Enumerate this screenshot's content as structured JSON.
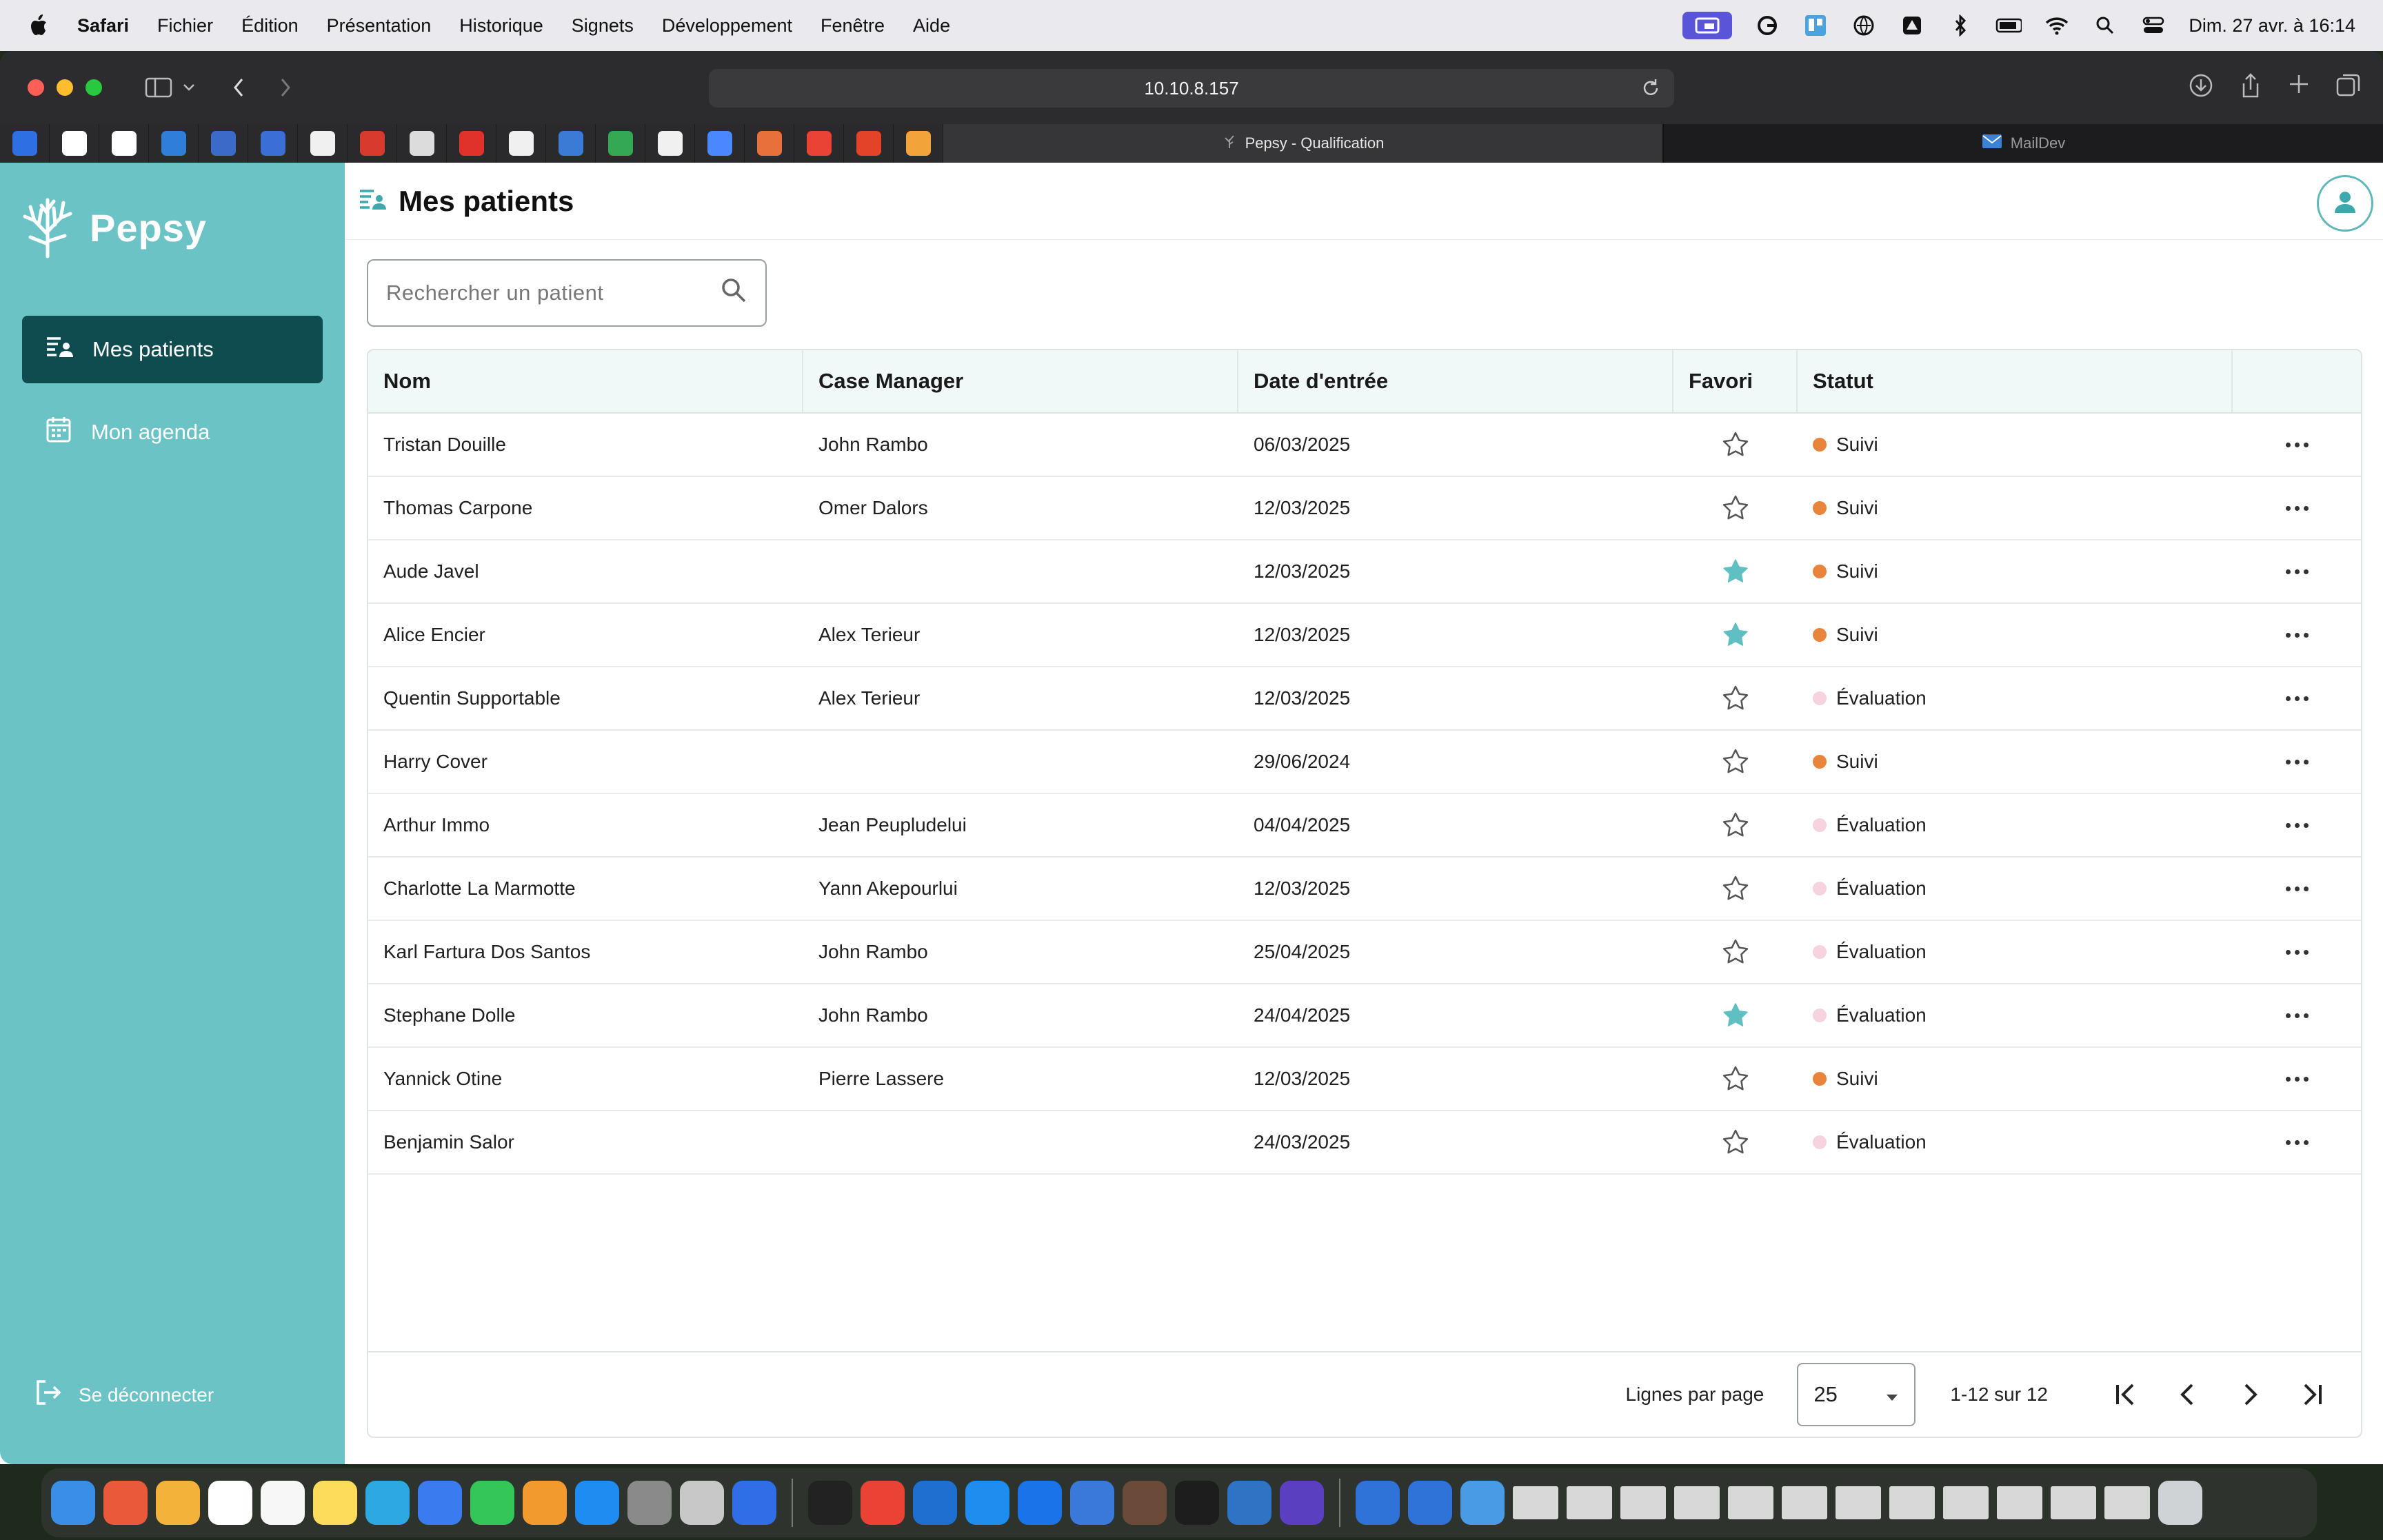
{
  "menubar": {
    "app": "Safari",
    "items": [
      "Fichier",
      "Édition",
      "Présentation",
      "Historique",
      "Signets",
      "Développement",
      "Fenêtre",
      "Aide"
    ],
    "clock": "Dim. 27 avr. à 16:14"
  },
  "browser": {
    "url": "10.10.8.157",
    "tabs": [
      {
        "label": "Pepsy - Qualification",
        "active": true
      },
      {
        "label": "MailDev",
        "active": false
      }
    ],
    "favorites_colors": [
      "#2f6fe4",
      "#ffffff",
      "#ffffff",
      "#2f7ed8",
      "#3a6bc9",
      "#3b6fd6",
      "#f0f0f0",
      "#d83a2e",
      "#dcdcdc",
      "#e0322a",
      "#f0f0f0",
      "#3a7bd5",
      "#34a853",
      "#f0f0f0",
      "#4a88ff",
      "#e8703a",
      "#ea4335",
      "#e24329",
      "#f2a33a"
    ]
  },
  "sidebar": {
    "brand": "Pepsy",
    "nav": [
      {
        "label": "Mes patients",
        "icon": "patients-list-icon",
        "active": true
      },
      {
        "label": "Mon agenda",
        "icon": "calendar-icon",
        "active": false
      }
    ],
    "logout": "Se déconnecter"
  },
  "header": {
    "title": "Mes patients"
  },
  "search": {
    "placeholder": "Rechercher un patient"
  },
  "table": {
    "columns": [
      "Nom",
      "Case Manager",
      "Date d'entrée",
      "Favori",
      "Statut"
    ],
    "rows": [
      {
        "nom": "Tristan Douille",
        "case_manager": "John Rambo",
        "date": "06/03/2025",
        "favori": false,
        "statut": "Suivi"
      },
      {
        "nom": "Thomas Carpone",
        "case_manager": "Omer Dalors",
        "date": "12/03/2025",
        "favori": false,
        "statut": "Suivi"
      },
      {
        "nom": "Aude Javel",
        "case_manager": "",
        "date": "12/03/2025",
        "favori": true,
        "statut": "Suivi"
      },
      {
        "nom": "Alice Encier",
        "case_manager": "Alex Terieur",
        "date": "12/03/2025",
        "favori": true,
        "statut": "Suivi"
      },
      {
        "nom": "Quentin Supportable",
        "case_manager": "Alex Terieur",
        "date": "12/03/2025",
        "favori": false,
        "statut": "Évaluation"
      },
      {
        "nom": "Harry Cover",
        "case_manager": "",
        "date": "29/06/2024",
        "favori": false,
        "statut": "Suivi"
      },
      {
        "nom": "Arthur Immo",
        "case_manager": "Jean Peupludelui",
        "date": "04/04/2025",
        "favori": false,
        "statut": "Évaluation"
      },
      {
        "nom": "Charlotte La Marmotte",
        "case_manager": "Yann Akepourlui",
        "date": "12/03/2025",
        "favori": false,
        "statut": "Évaluation"
      },
      {
        "nom": "Karl Fartura Dos Santos",
        "case_manager": "John Rambo",
        "date": "25/04/2025",
        "favori": false,
        "statut": "Évaluation"
      },
      {
        "nom": "Stephane Dolle",
        "case_manager": "John Rambo",
        "date": "24/04/2025",
        "favori": true,
        "statut": "Évaluation"
      },
      {
        "nom": "Yannick Otine",
        "case_manager": "Pierre Lassere",
        "date": "12/03/2025",
        "favori": false,
        "statut": "Suivi"
      },
      {
        "nom": "Benjamin Salor",
        "case_manager": "",
        "date": "24/03/2025",
        "favori": false,
        "statut": "Évaluation"
      }
    ],
    "status_colors": {
      "Suivi": "#e8843c",
      "Évaluation": "#f7d3df"
    },
    "star_color": "#5fbfc3"
  },
  "pagination": {
    "rows_per_page_label": "Lignes par page",
    "rows_per_page_value": "25",
    "range": "1-12 sur 12"
  },
  "colors": {
    "sidebar": "#6cc3c6",
    "nav_active": "#0f4c4f",
    "table_header": "#f1f8f8"
  }
}
